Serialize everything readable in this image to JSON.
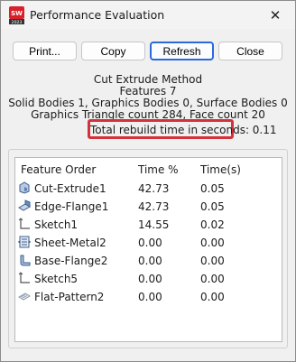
{
  "window": {
    "title": "Performance Evaluation",
    "app_year": "2023",
    "close_glyph": "✕"
  },
  "buttons": {
    "print": "Print...",
    "copy": "Copy",
    "refresh": "Refresh",
    "close": "Close"
  },
  "summary": {
    "part_name": "Cut Extrude Method",
    "features": "Features 7",
    "bodies": "Solid Bodies 1, Graphics Bodies 0, Surface Bodies 0",
    "graphics": "Graphics Triangle count 284, Face count 20",
    "rebuild_time": "Total rebuild time in seconds: 0.11"
  },
  "table": {
    "headers": {
      "feature": "Feature Order",
      "pct": "Time %",
      "time": "Time(s)"
    },
    "rows": [
      {
        "icon": "cut-extrude-icon",
        "name": "Cut-Extrude1",
        "pct": "42.73",
        "time": "0.05"
      },
      {
        "icon": "edge-flange-icon",
        "name": "Edge-Flange1",
        "pct": "42.73",
        "time": "0.05"
      },
      {
        "icon": "sketch-icon",
        "name": "Sketch1",
        "pct": "14.55",
        "time": "0.02"
      },
      {
        "icon": "sheet-metal-icon",
        "name": "Sheet-Metal2",
        "pct": "0.00",
        "time": "0.00"
      },
      {
        "icon": "base-flange-icon",
        "name": "Base-Flange2",
        "pct": "0.00",
        "time": "0.00"
      },
      {
        "icon": "sketch-icon",
        "name": "Sketch5",
        "pct": "0.00",
        "time": "0.00"
      },
      {
        "icon": "flat-pattern-icon",
        "name": "Flat-Pattern2",
        "pct": "0.00",
        "time": "0.00"
      }
    ]
  },
  "colors": {
    "highlight_border": "#d6303a",
    "default_button_border": "#2b6ad6",
    "app_icon_red": "#d8202a"
  }
}
